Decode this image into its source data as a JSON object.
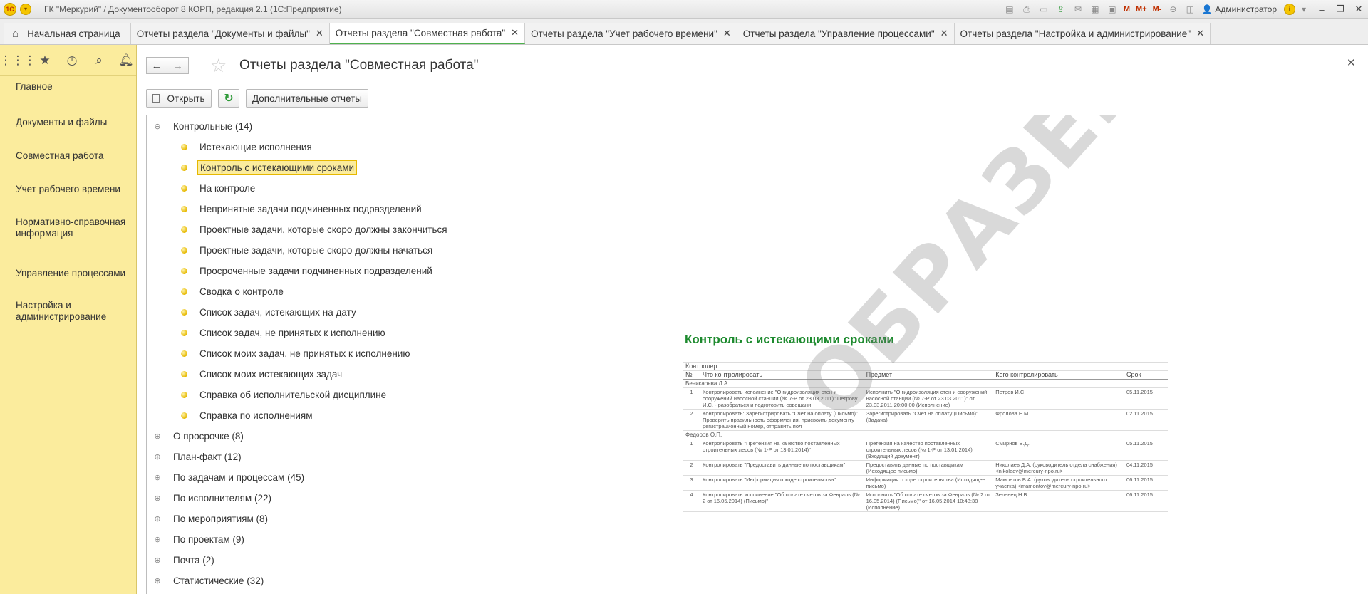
{
  "window": {
    "title": "ГК \"Меркурий\" / Документооборот 8 КОРП, редакция 2.1  (1С:Предприятие)",
    "logo": "1С",
    "user": "Администратор",
    "memory_buttons": [
      "M",
      "M+",
      "M-"
    ]
  },
  "tabs": [
    {
      "label": "Начальная страница",
      "closable": false,
      "active": false
    },
    {
      "label": "Отчеты раздела \"Документы и файлы\"",
      "closable": true,
      "active": false
    },
    {
      "label": "Отчеты раздела \"Совместная работа\"",
      "closable": true,
      "active": true
    },
    {
      "label": "Отчеты раздела \"Учет рабочего времени\"",
      "closable": true,
      "active": false
    },
    {
      "label": "Отчеты раздела \"Управление процессами\"",
      "closable": true,
      "active": false
    },
    {
      "label": "Отчеты раздела \"Настройка и администрирование\"",
      "closable": true,
      "active": false
    }
  ],
  "sidebar": {
    "items": [
      {
        "label": "Главное"
      },
      {
        "label": "Документы и файлы"
      },
      {
        "label": "Совместная работа"
      },
      {
        "label": "Учет рабочего времени"
      },
      {
        "label": "Нормативно-справочная информация"
      },
      {
        "label": "Управление процессами"
      },
      {
        "label": "Настройка и администрирование"
      }
    ]
  },
  "page": {
    "title": "Отчеты раздела \"Совместная работа\"",
    "open_button": "Открыть",
    "more_reports_button": "Дополнительные отчеты"
  },
  "tree": {
    "groups": [
      {
        "label": "Контрольные (14)",
        "expanded": true,
        "children": [
          "Истекающие исполнения",
          "Контроль с истекающими сроками",
          "На контроле",
          "Непринятые задачи подчиненных подразделений",
          "Проектные задачи, которые скоро должны закончиться",
          "Проектные задачи, которые скоро должны начаться",
          "Просроченные задачи подчиненных подразделений",
          "Сводка о контроле",
          "Список задач, истекающих на дату",
          "Список задач, не принятых к исполнению",
          "Список моих задач, не принятых к исполнению",
          "Список моих истекающих задач",
          "Справка об исполнительской дисциплине",
          "Справка по исполнениям"
        ]
      },
      {
        "label": "О просрочке (8)",
        "expanded": false,
        "children": []
      },
      {
        "label": "План-факт (12)",
        "expanded": false,
        "children": []
      },
      {
        "label": "По задачам и процессам (45)",
        "expanded": false,
        "children": []
      },
      {
        "label": "По исполнителям (22)",
        "expanded": false,
        "children": []
      },
      {
        "label": "По мероприятиям (8)",
        "expanded": false,
        "children": []
      },
      {
        "label": "По проектам (9)",
        "expanded": false,
        "children": []
      },
      {
        "label": "Почта (2)",
        "expanded": false,
        "children": []
      },
      {
        "label": "Статистические (32)",
        "expanded": false,
        "children": []
      }
    ],
    "selected": "Контроль с истекающими сроками"
  },
  "preview": {
    "title": "Контроль с истекающими сроками",
    "watermark": "ОБРАЗЕЦ",
    "caption": "Контролер",
    "columns": [
      "№",
      "Что контролировать",
      "Предмет",
      "Кого контролировать",
      "Срок"
    ],
    "groups": [
      {
        "name": "Веникаонва Л.А.",
        "rows": [
          [
            "1",
            "Контролировать исполнение \"О гидроизоляция стен и сооружений насосной станции (№ 7-Р от 23.03.2011)\" Петрову И.С. - разобраться и подготовить совещани",
            "Исполнить \"О гидроизоляция стен и сооружений насосной станции (№ 7-Р от 23.03.2011)\" от 23.03.2011 20:00:00 (Исполнение)",
            "Петров И.С.",
            "05.11.2015"
          ],
          [
            "2",
            "Контролировать: Зарегистрировать \"Счет на оплату (Письмо)\" Проверить правильность оформления, присвоить документу регистрационный номер, отправить пол",
            "Зарегистрировать \"Счет на оплату (Письмо)\" (Задача)",
            "Фролова Е.М.",
            "02.11.2015"
          ]
        ]
      },
      {
        "name": "Федоров О.П.",
        "rows": [
          [
            "1",
            "Контролировать \"Претензия на качество поставленных строительных лесов (№ 1-Р от 13.01.2014)\"",
            "Претензия на качество поставленных строительных лесов (№ 1-Р от 13.01.2014) (Входящий документ)",
            "Смирнов В.Д.",
            "05.11.2015"
          ],
          [
            "2",
            "Контролировать \"Предоставить данные по поставщикам\"",
            "Предоставить данные по поставщикам (Исходящее письмо)",
            "Николаев Д.А. (руководитель отдела снабжения) <nikolaev@mercury-npo.ru>",
            "04.11.2015"
          ],
          [
            "3",
            "Контролировать \"Информация о ходе строительства\"",
            "Информация о ходе строительства (Исходящее письмо)",
            "Мамонтов В.А. (руководитель строительного участка) <mamontov@mercury-npo.ru>",
            "06.11.2015"
          ],
          [
            "4",
            "Контролировать исполнение \"Об оплате счетов за Февраль (№ 2 от 16.05.2014) (Письмо)\"",
            "Исполнить \"Об оплате счетов за Февраль (№ 2 от 16.05.2014) (Письмо)\" от 16.05.2014 10:48:38 (Исполнение)",
            "Зеленец Н.В.",
            "06.11.2015"
          ]
        ]
      }
    ]
  },
  "icons": {
    "apps": "grid-icon",
    "favorites": "star-icon",
    "history": "history-icon",
    "search": "search-icon",
    "notifications": "bell-icon"
  },
  "colors": {
    "sidebar_bg": "#fbec9d",
    "active_tab_accent": "#4fb24e",
    "report_title": "#1d8a2e",
    "selection_border": "#e6b800"
  }
}
